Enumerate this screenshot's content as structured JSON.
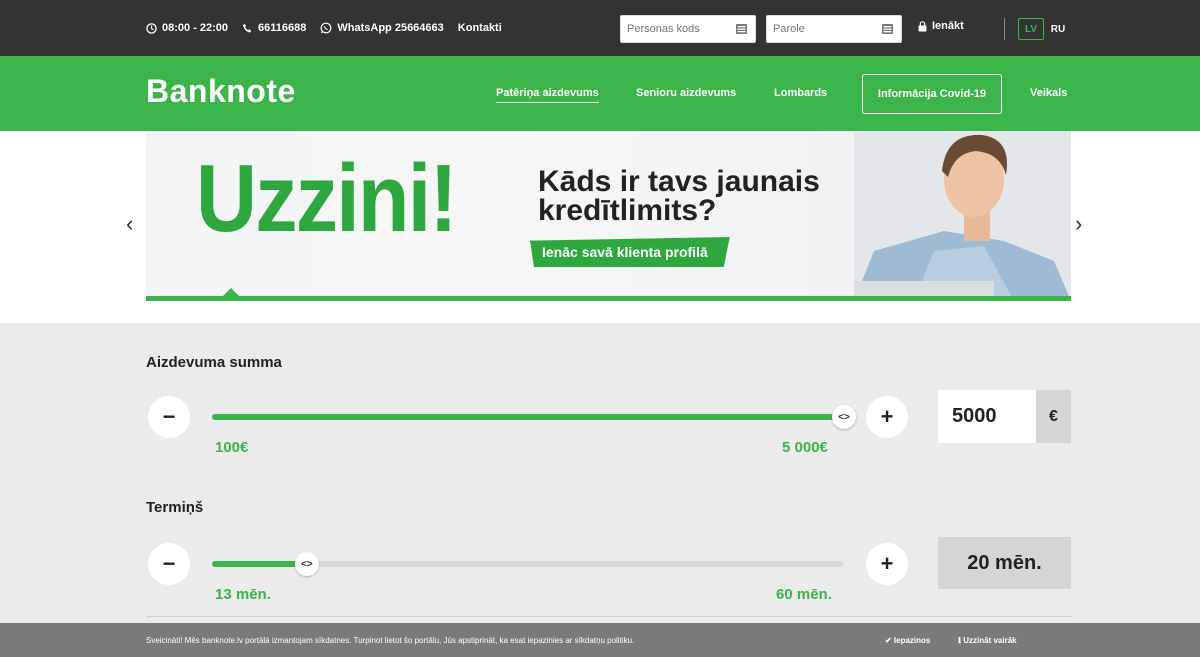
{
  "topbar": {
    "hours": "08:00 - 22:00",
    "phone": "66116688",
    "whatsapp": "WhatsApp 25664663",
    "contacts": "Kontakti",
    "personal_code_placeholder": "Personas kods",
    "password_placeholder": "Parole",
    "login_label": "Ienākt",
    "languages": [
      "LV",
      "RU"
    ],
    "active_language": "LV"
  },
  "nav": {
    "logo": "Banknote",
    "links": [
      "Patēriņa aizdevums",
      "Senioru aizdevums",
      "Lombards"
    ],
    "covid_button": "Informācija Covid-19",
    "shop": "Veikals"
  },
  "banner": {
    "big_word": "Uzzini!",
    "headline_line1": "Kāds ir tavs jaunais",
    "headline_line2": "kredītlimits?",
    "cta": "Ienāc savā klienta profilā",
    "prev_arrow": "‹",
    "next_arrow": "›"
  },
  "calculator": {
    "amount": {
      "label": "Aizdevuma summa",
      "min_label": "100€",
      "max_label": "5 000€",
      "value": "5000",
      "currency": "€",
      "fill_fraction": 1.0
    },
    "term": {
      "label": "Termiņš",
      "min_label": "13 mēn.",
      "max_label": "60 mēn.",
      "value": "20 mēn.",
      "fill_fraction": 0.15
    },
    "minus": "−",
    "plus": "+",
    "handle_glyph": "<>"
  },
  "cookie": {
    "message": "Sveicināti! Mēs banknote.lv portālā izmantojam sīkdatnes. Turpinot lietot šo portālu, Jūs apstiprināt, ka esat iepazinies ar sīkdatņu politiku.",
    "accept": "✔ Iepazinos",
    "more": "ℹ Uzzināt vairāk"
  },
  "colors": {
    "brand_green": "#3bb54a",
    "topbar": "#333333",
    "cookie_bar": "#7a7a7a"
  },
  "icons": [
    "clock-icon",
    "phone-icon",
    "whatsapp-icon",
    "keyboard-icon",
    "lock-icon",
    "check-icon",
    "info-icon"
  ]
}
